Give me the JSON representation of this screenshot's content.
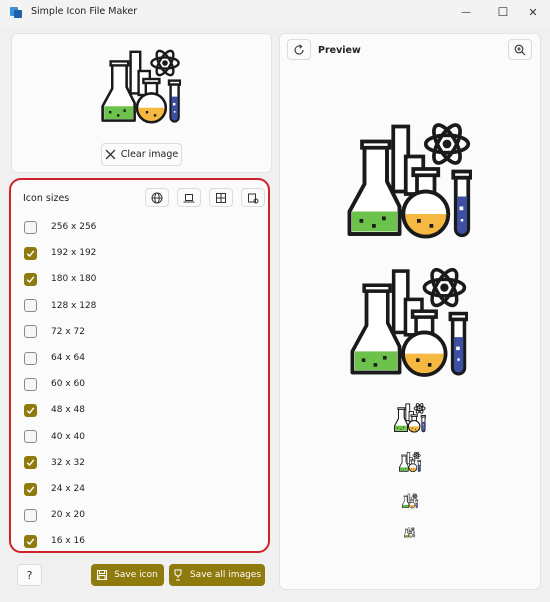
{
  "window": {
    "title": "Simple Icon File Maker",
    "minimize_glyph": "—",
    "maximize_glyph": "☐",
    "close_glyph": "✕"
  },
  "source_image": {
    "icon": "chemistry-flasks-image",
    "clear_label": "Clear image"
  },
  "icon_sizes": {
    "title": "Icon sizes",
    "tools": [
      "globe-icon",
      "laptop-icon",
      "grid-icon",
      "settings-icon"
    ],
    "items": [
      {
        "label": "256 x 256",
        "checked": false
      },
      {
        "label": "192 x 192",
        "checked": true
      },
      {
        "label": "180 x 180",
        "checked": true
      },
      {
        "label": "128 x 128",
        "checked": false
      },
      {
        "label": "72 x 72",
        "checked": false
      },
      {
        "label": "64 x 64",
        "checked": false
      },
      {
        "label": "60 x 60",
        "checked": false
      },
      {
        "label": "48 x 48",
        "checked": true
      },
      {
        "label": "40 x 40",
        "checked": false
      },
      {
        "label": "32 x 32",
        "checked": true
      },
      {
        "label": "24 x 24",
        "checked": true
      },
      {
        "label": "20 x 20",
        "checked": false
      },
      {
        "label": "16 x 16",
        "checked": true
      }
    ]
  },
  "footer": {
    "help_label": "?",
    "save_icon_label": "Save icon",
    "save_all_label": "Save all images"
  },
  "preview": {
    "title": "Preview",
    "images": [
      "192 x 192",
      "180 x 180",
      "48 x 48",
      "32 x 32",
      "24 x 24",
      "16 x 16"
    ]
  },
  "colors": {
    "accent": "#8f7a0d",
    "highlight": "#d0202a",
    "liquid_green": "#6cc24a",
    "liquid_orange": "#f5b942",
    "liquid_blue": "#3c4fa3"
  }
}
